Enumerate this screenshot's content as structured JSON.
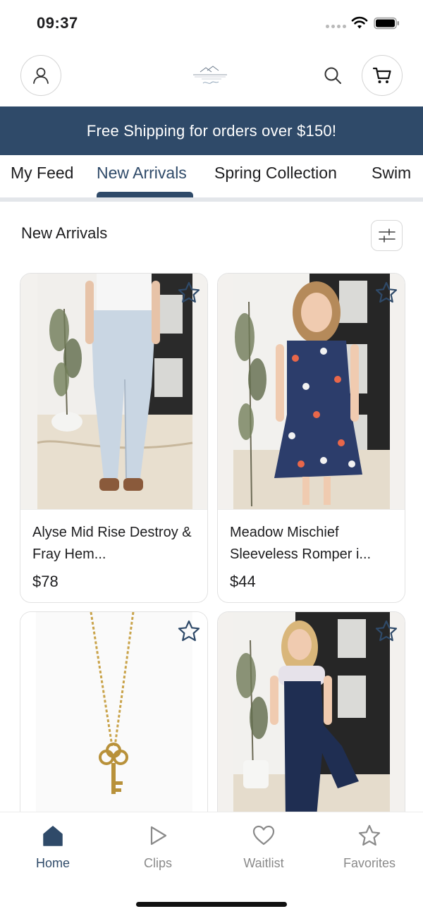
{
  "status_bar": {
    "time": "09:37"
  },
  "banner": {
    "text": "Free Shipping for orders over $150!"
  },
  "tabs": [
    {
      "label": "My Feed"
    },
    {
      "label": "New Arrivals"
    },
    {
      "label": "Spring Collection"
    },
    {
      "label": "Swim"
    }
  ],
  "active_tab": "New Arrivals",
  "section": {
    "title": "New Arrivals"
  },
  "products": [
    {
      "name": "Alyse Mid Rise Destroy & Fray Hem...",
      "price": "$78",
      "image": "light-wash-flare-jeans"
    },
    {
      "name": "Meadow Mischief Sleeveless Romper i...",
      "price": "$44",
      "image": "floral-sleeveless-romper"
    },
    {
      "name": "",
      "price": "",
      "image": "gold-key-pendant-necklace"
    },
    {
      "name": "",
      "price": "",
      "image": "navy-wide-leg-jumpsuit"
    }
  ],
  "bottom_nav": [
    {
      "label": "Home",
      "icon": "home-icon",
      "active": true
    },
    {
      "label": "Clips",
      "icon": "play-icon",
      "active": false
    },
    {
      "label": "Waitlist",
      "icon": "heart-icon",
      "active": false
    },
    {
      "label": "Favorites",
      "icon": "star-icon",
      "active": false
    }
  ],
  "colors": {
    "brand_navy": "#2f4a69",
    "tab_rule": "#e3e6ea",
    "inactive_nav": "#8a8a8a"
  }
}
